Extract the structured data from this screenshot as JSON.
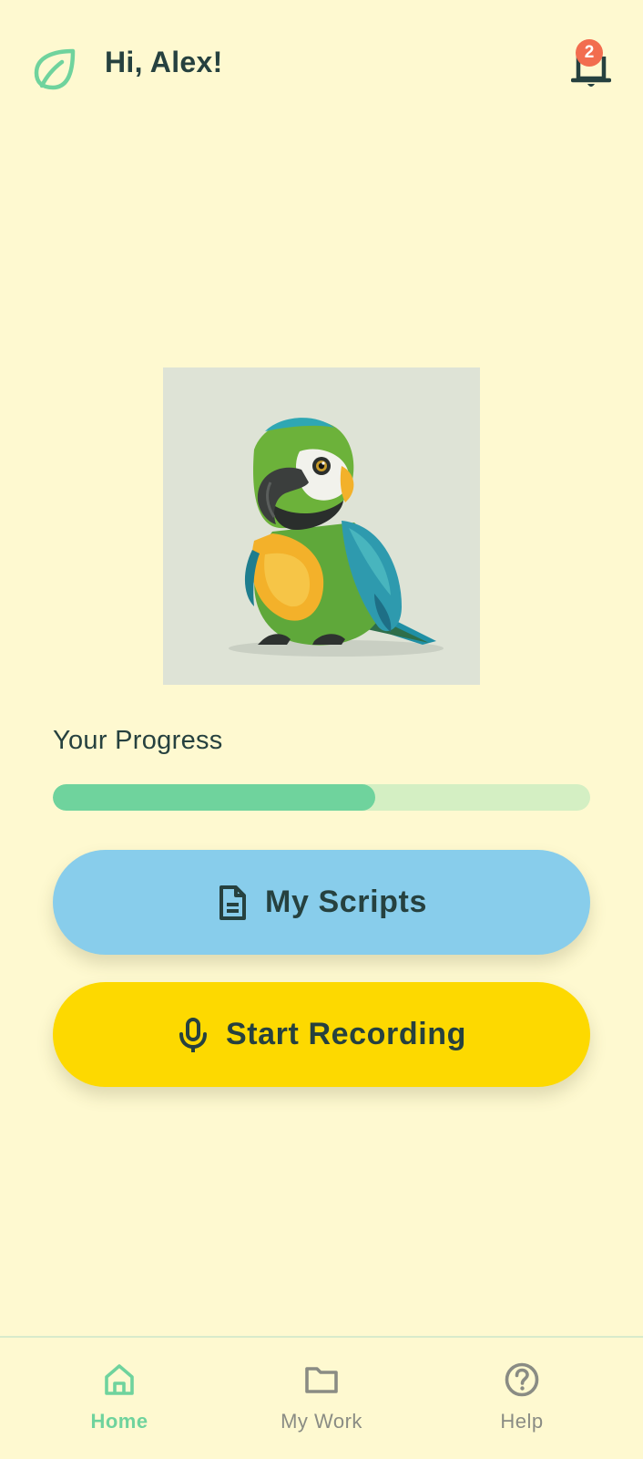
{
  "header": {
    "greeting": "Hi, Alex!",
    "notification_count": "2",
    "logo_icon": "leaf-icon",
    "bell_icon": "bell-icon"
  },
  "progress": {
    "label": "Your Progress",
    "value_percent": 60
  },
  "actions": {
    "scripts_label": "My Scripts",
    "scripts_icon": "document-icon",
    "record_label": "Start Recording",
    "record_icon": "microphone-icon"
  },
  "nav": {
    "items": [
      {
        "label": "Home",
        "icon": "home-icon",
        "active": true
      },
      {
        "label": "My Work",
        "icon": "folder-icon",
        "active": false
      },
      {
        "label": "Help",
        "icon": "help-icon",
        "active": false
      }
    ]
  },
  "colors": {
    "background": "#FEF9D0",
    "text": "#26413F",
    "accent_green": "#6FD39D",
    "scripts_button": "#88CDEB",
    "record_button": "#FDD900",
    "badge": "#F26D4F"
  }
}
